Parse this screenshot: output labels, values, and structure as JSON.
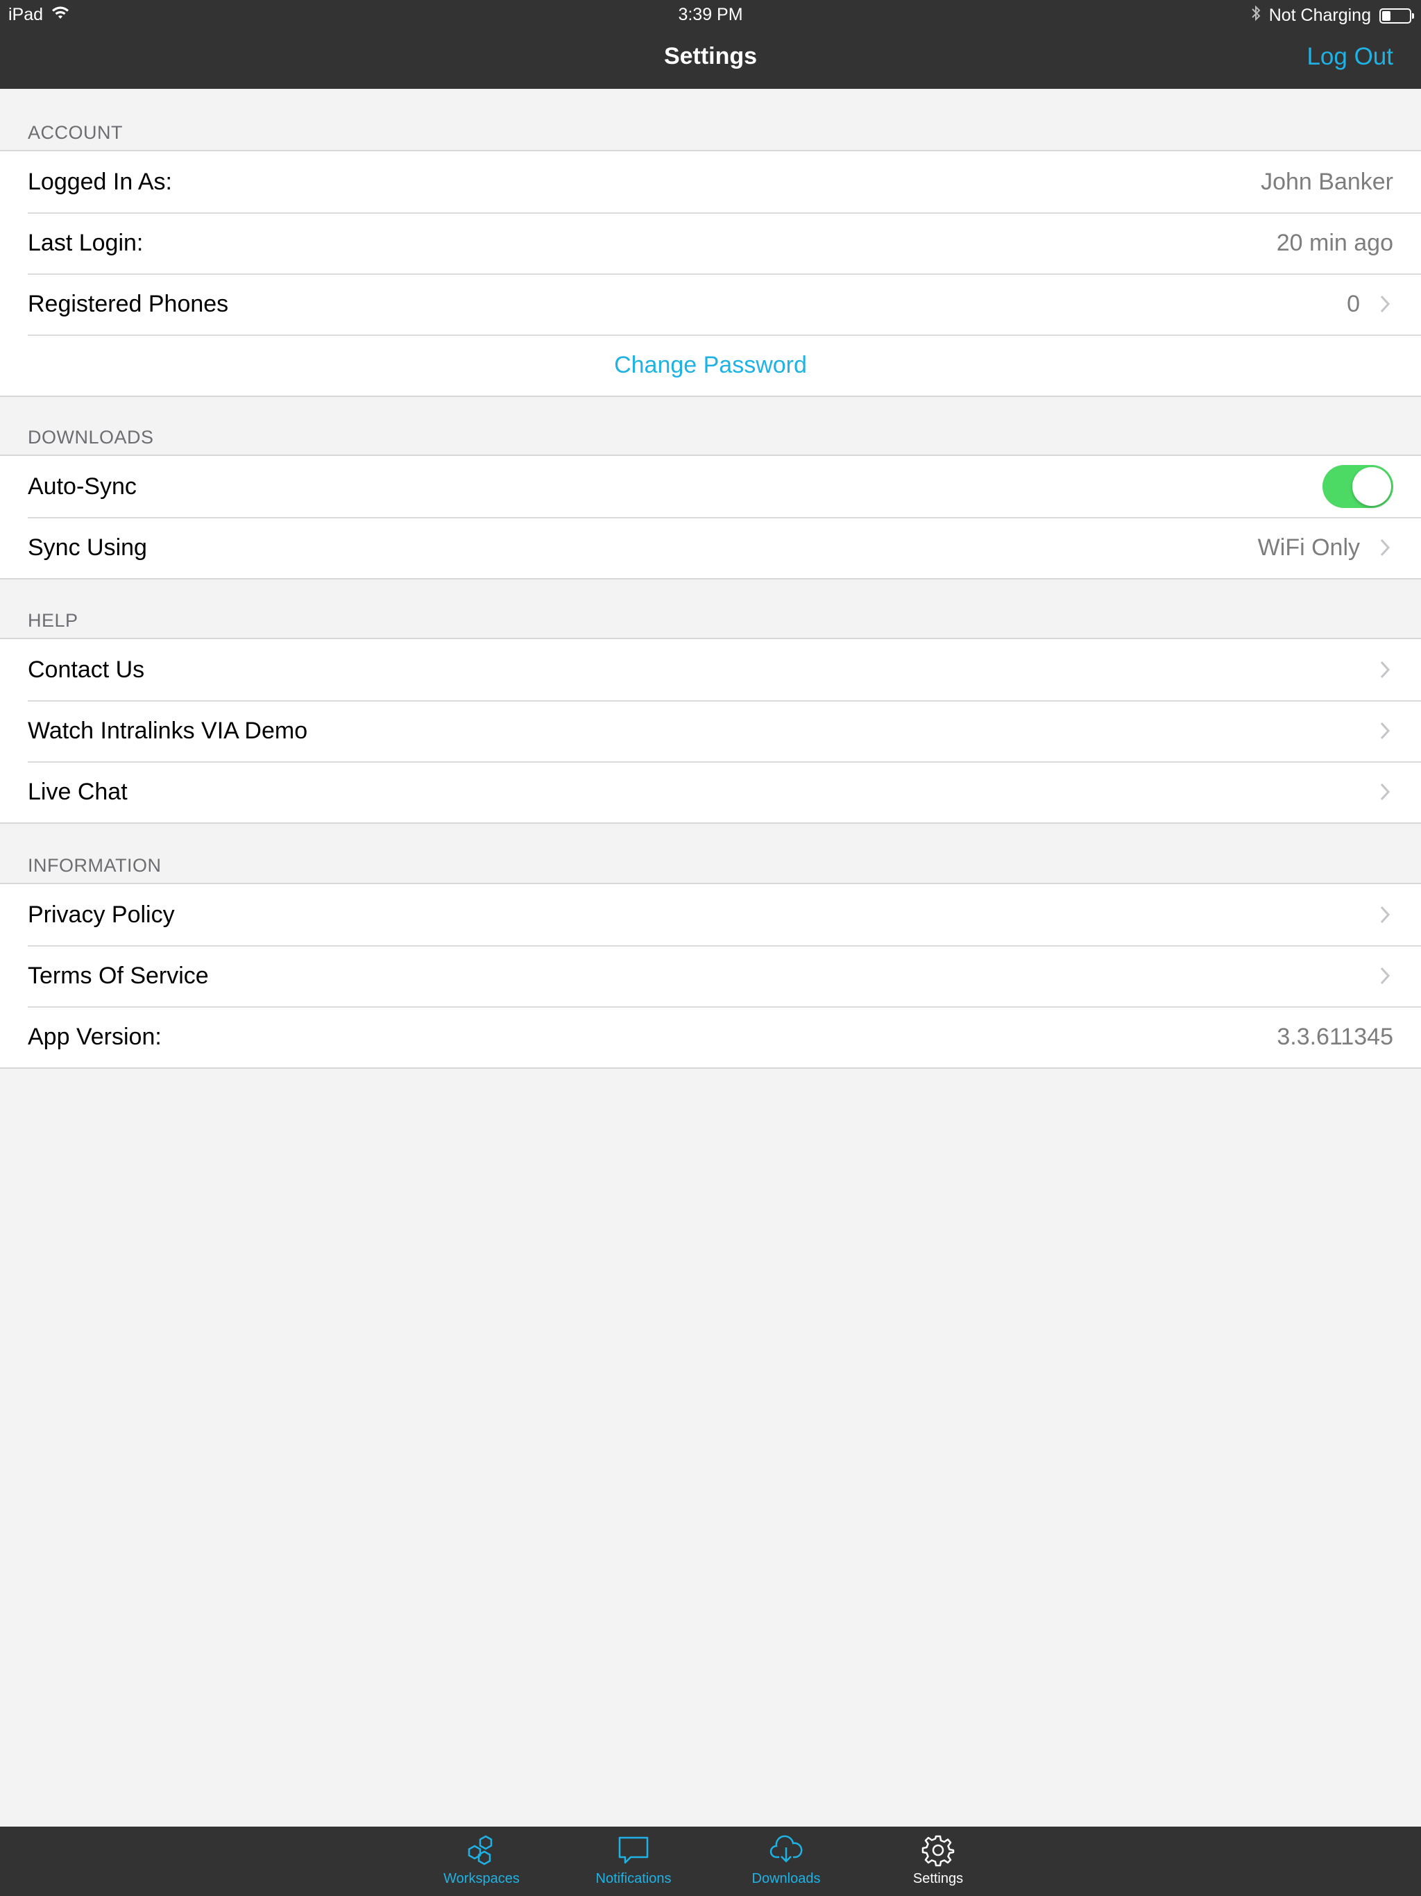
{
  "status_bar": {
    "device": "iPad",
    "time": "3:39 PM",
    "charging": "Not Charging"
  },
  "nav": {
    "title": "Settings",
    "action": "Log Out"
  },
  "colors": {
    "accent": "#1fb2e4",
    "bar": "#333333",
    "toggle_on": "#4cd964",
    "background": "#f3f3f3"
  },
  "sections": {
    "account": {
      "header": "ACCOUNT",
      "logged_in_label": "Logged In As:",
      "logged_in_value": "John Banker",
      "last_login_label": "Last Login:",
      "last_login_value": "20 min ago",
      "phones_label": "Registered Phones",
      "phones_value": "0",
      "change_password": "Change Password"
    },
    "downloads": {
      "header": "DOWNLOADS",
      "auto_sync_label": "Auto-Sync",
      "auto_sync_on": true,
      "sync_using_label": "Sync Using",
      "sync_using_value": "WiFi Only"
    },
    "help": {
      "header": "HELP",
      "contact": "Contact Us",
      "demo": "Watch Intralinks VIA Demo",
      "chat": "Live Chat"
    },
    "information": {
      "header": "INFORMATION",
      "privacy": "Privacy Policy",
      "terms": "Terms Of Service",
      "version_label": "App Version:",
      "version_value": "3.3.611345"
    }
  },
  "tabbar": {
    "tabs": [
      {
        "label": "Workspaces",
        "icon": "workspaces-icon",
        "active": false
      },
      {
        "label": "Notifications",
        "icon": "chat-bubble-icon",
        "active": false
      },
      {
        "label": "Downloads",
        "icon": "cloud-download-icon",
        "active": false
      },
      {
        "label": "Settings",
        "icon": "gear-icon",
        "active": true
      }
    ]
  }
}
